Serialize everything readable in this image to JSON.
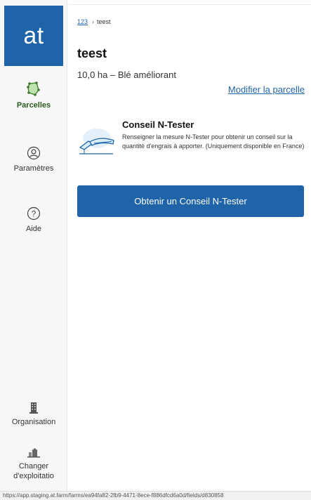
{
  "app": {
    "logo_text": "at"
  },
  "sidebar": {
    "items": [
      {
        "label": "Parcelles",
        "icon": "field-icon"
      },
      {
        "label": "Paramètres",
        "icon": "user-icon"
      },
      {
        "label": "Aide",
        "icon": "help-icon"
      }
    ],
    "bottom_items": [
      {
        "label": "Organisation",
        "icon": "building-icon"
      },
      {
        "label": "Changer d'exploitatio",
        "icon": "farm-icon"
      }
    ]
  },
  "breadcrumb": {
    "root": "123",
    "current": "teest"
  },
  "field": {
    "name": "teest",
    "summary": "10,0 ha – Blé améliorant",
    "modify_label": "Modifier la parcelle"
  },
  "ntester": {
    "title": "Conseil N-Tester",
    "description": "Renseigner la mesure N-Tester pour obtenir un conseil sur la quantité d'engrais à apporter. (Uniquement disponible en France)",
    "button_label": "Obtenir un Conseil N-Tester"
  },
  "status_bar": {
    "url": "https://app.staging.at.farm/farms/ea94fa82-2fb9-4471-8ece-f886dfcd6a0d/fields/d830858"
  },
  "colors": {
    "primary": "#1f64a8",
    "active_nav": "#2a5a1e"
  }
}
